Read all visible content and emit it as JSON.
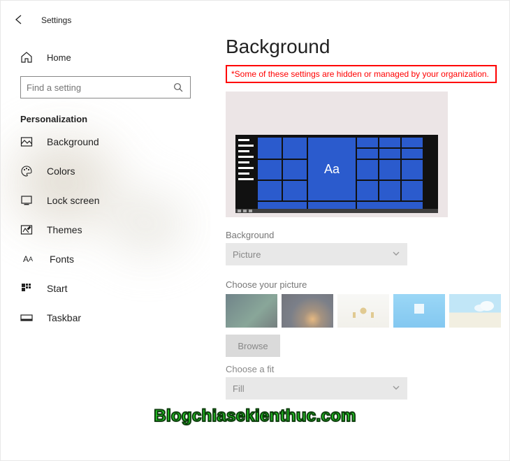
{
  "titlebar": {
    "title": "Settings"
  },
  "sidebar": {
    "home_label": "Home",
    "search_placeholder": "Find a setting",
    "section_title": "Personalization",
    "items": [
      {
        "label": "Background"
      },
      {
        "label": "Colors"
      },
      {
        "label": "Lock screen"
      },
      {
        "label": "Themes"
      },
      {
        "label": "Fonts"
      },
      {
        "label": "Start"
      },
      {
        "label": "Taskbar"
      }
    ]
  },
  "main": {
    "page_title": "Background",
    "org_warning": "*Some of these settings are hidden or managed by your organization.",
    "preview_sample_text": "Aa",
    "background_label": "Background",
    "background_value": "Picture",
    "choose_picture_label": "Choose your picture",
    "browse_label": "Browse",
    "fit_label": "Choose a fit",
    "fit_value": "Fill"
  },
  "watermark": "Blogchiasekienthuc.com"
}
